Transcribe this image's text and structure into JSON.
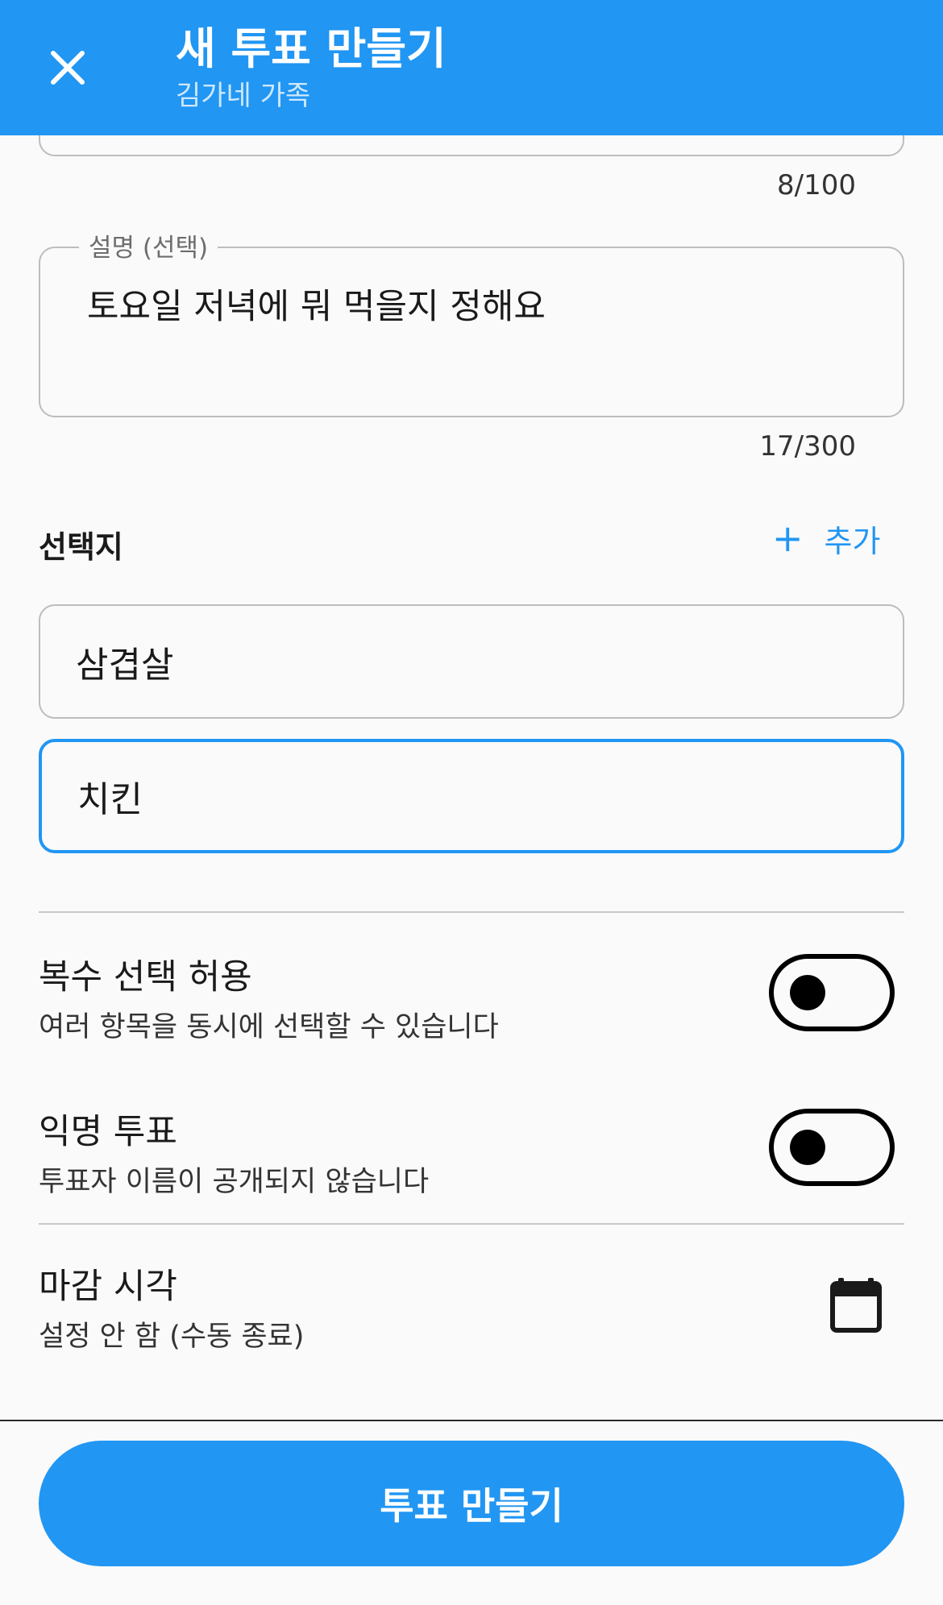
{
  "app_bar": {
    "title": "새 투표 만들기",
    "subtitle": "김가네 가족",
    "close_icon": "close-icon",
    "background_color": "#2196f3"
  },
  "form": {
    "title_counter": "8/100",
    "description": {
      "label": "설명 (선택)",
      "value": "토요일 저녁에 뭐 먹을지 정해요",
      "counter": "17/300"
    },
    "options": {
      "section_title": "선택지",
      "add_label": "추가",
      "add_icon": "plus-icon",
      "items": [
        {
          "value": "삼겹살",
          "focused": false
        },
        {
          "value": "치킨",
          "focused": true
        }
      ]
    },
    "settings": {
      "multiple_choice": {
        "title": "복수 선택 허용",
        "description": "여러 항목을 동시에 선택할 수 있습니다",
        "enabled": false
      },
      "anonymous": {
        "title": "익명 투표",
        "description": "투표자 이름이 공개되지 않습니다",
        "enabled": false
      },
      "deadline": {
        "title": "마감 시각",
        "value": "설정 안 함 (수동 종료)",
        "icon": "calendar-icon"
      }
    }
  },
  "submit": {
    "label": "투표 만들기"
  }
}
